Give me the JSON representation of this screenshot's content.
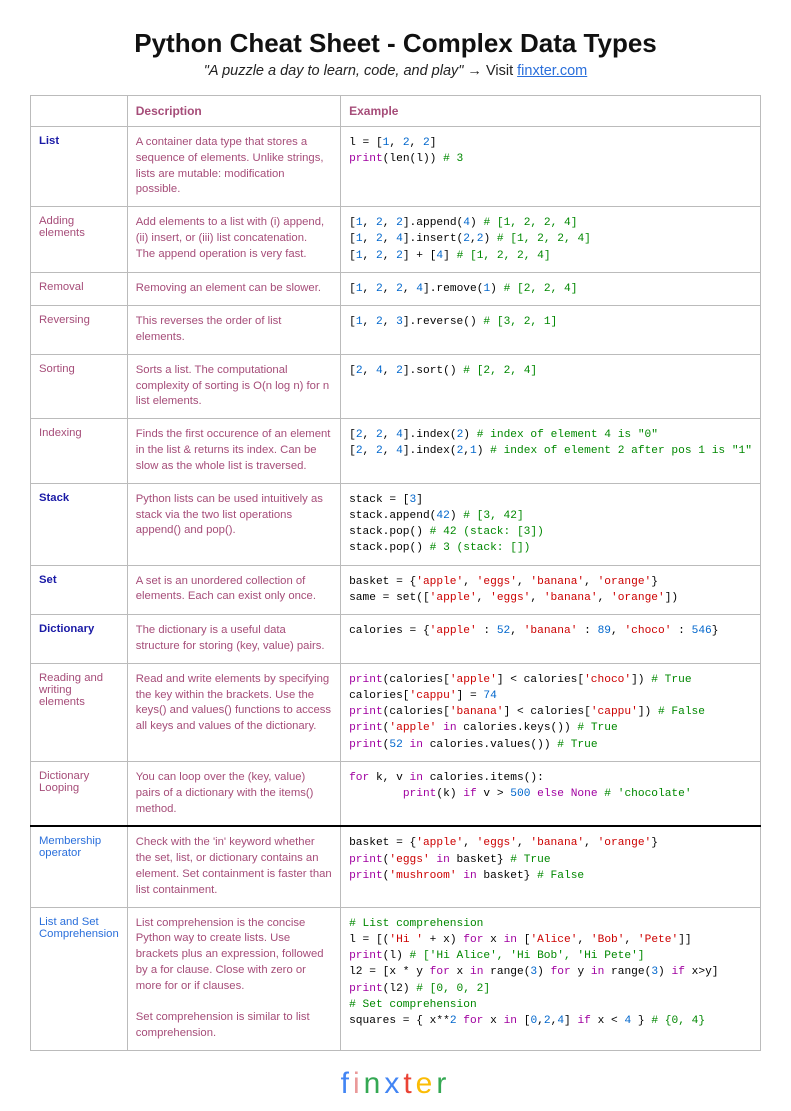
{
  "header": {
    "title": "Python Cheat Sheet - Complex Data Types",
    "subtitle_quote": "\"A puzzle a day to learn, code, and play\"",
    "subtitle_arrow": " → Visit ",
    "subtitle_link": "finxter.com"
  },
  "columns": {
    "c1": "",
    "c2": "Description",
    "c3": "Example"
  },
  "rows": [
    {
      "bold": true,
      "topic": "List",
      "desc": "A container data type that stores a sequence of elements. Unlike strings, lists are mutable: modification possible.",
      "code": [
        [
          "l = [",
          {
            "n": "1"
          },
          ", ",
          {
            "n": "2"
          },
          ", ",
          {
            "n": "2"
          },
          "]"
        ],
        [
          {
            "k": "print"
          },
          "(len(l)) ",
          {
            "c": "# 3"
          }
        ]
      ]
    },
    {
      "bold": false,
      "topic": "Adding elements",
      "desc": "Add elements to a list with (i) append, (ii) insert, or (iii) list concatenation.\nThe append operation is very fast.",
      "code": [
        [
          "[",
          {
            "n": "1"
          },
          ", ",
          {
            "n": "2"
          },
          ", ",
          {
            "n": "2"
          },
          "].append(",
          {
            "n": "4"
          },
          ") ",
          {
            "c": "# [1, 2, 2, 4]"
          }
        ],
        [
          "[",
          {
            "n": "1"
          },
          ", ",
          {
            "n": "2"
          },
          ", ",
          {
            "n": "4"
          },
          "].insert(",
          {
            "n": "2"
          },
          ",",
          {
            "n": "2"
          },
          ") ",
          {
            "c": "# [1, 2, 2, 4]"
          }
        ],
        [
          "[",
          {
            "n": "1"
          },
          ", ",
          {
            "n": "2"
          },
          ", ",
          {
            "n": "2"
          },
          "] + [",
          {
            "n": "4"
          },
          "] ",
          {
            "c": "# [1, 2, 2, 4]"
          }
        ]
      ]
    },
    {
      "bold": false,
      "topic": "Removal",
      "desc": "Removing an element can be slower.",
      "code": [
        [
          "[",
          {
            "n": "1"
          },
          ", ",
          {
            "n": "2"
          },
          ", ",
          {
            "n": "2"
          },
          ", ",
          {
            "n": "4"
          },
          "].remove(",
          {
            "n": "1"
          },
          ") ",
          {
            "c": "# [2, 2, 4]"
          }
        ]
      ]
    },
    {
      "bold": false,
      "topic": "Reversing",
      "desc": "This reverses the order of list elements.",
      "code": [
        [
          "[",
          {
            "n": "1"
          },
          ", ",
          {
            "n": "2"
          },
          ", ",
          {
            "n": "3"
          },
          "].reverse() ",
          {
            "c": "# [3, 2, 1]"
          }
        ]
      ]
    },
    {
      "bold": false,
      "topic": "Sorting",
      "desc": "Sorts a list. The computational complexity of sorting is O(n log n) for n list elements.",
      "code": [
        [
          "[",
          {
            "n": "2"
          },
          ", ",
          {
            "n": "4"
          },
          ", ",
          {
            "n": "2"
          },
          "].sort() ",
          {
            "c": "# [2, 2, 4]"
          }
        ]
      ]
    },
    {
      "bold": false,
      "topic": "Indexing",
      "desc": "Finds the first occurence of an element in the list & returns its index. Can be slow as the whole list is traversed.",
      "code": [
        [
          "[",
          {
            "n": "2"
          },
          ", ",
          {
            "n": "2"
          },
          ", ",
          {
            "n": "4"
          },
          "].index(",
          {
            "n": "2"
          },
          ") ",
          {
            "c": "# index of element 4 is \"0\""
          }
        ],
        [
          "[",
          {
            "n": "2"
          },
          ", ",
          {
            "n": "2"
          },
          ", ",
          {
            "n": "4"
          },
          "].index(",
          {
            "n": "2"
          },
          ",",
          {
            "n": "1"
          },
          ") ",
          {
            "c": "# index of element 2 after pos 1 is \"1\""
          }
        ]
      ]
    },
    {
      "bold": true,
      "topic": "Stack",
      "desc": "Python lists can be used intuitively as stack via the two list operations append() and pop().",
      "code": [
        [
          "stack = [",
          {
            "n": "3"
          },
          "]"
        ],
        [
          "stack.append(",
          {
            "n": "42"
          },
          ") ",
          {
            "c": "# [3, 42]"
          }
        ],
        [
          "stack.pop() ",
          {
            "c": "# 42 (stack: [3])"
          }
        ],
        [
          "stack.pop() ",
          {
            "c": "# 3 (stack: [])"
          }
        ]
      ]
    },
    {
      "bold": true,
      "topic": "Set",
      "desc": "A set is an unordered collection of elements. Each can exist only once.",
      "code": [
        [
          "basket = {",
          {
            "s": "'apple'"
          },
          ", ",
          {
            "s": "'eggs'"
          },
          ", ",
          {
            "s": "'banana'"
          },
          ", ",
          {
            "s": "'orange'"
          },
          "}"
        ],
        [
          "same = set([",
          {
            "s": "'apple'"
          },
          ", ",
          {
            "s": "'eggs'"
          },
          ", ",
          {
            "s": "'banana'"
          },
          ", ",
          {
            "s": "'orange'"
          },
          "])"
        ]
      ]
    },
    {
      "bold": true,
      "topic": "Dictionary",
      "desc": "The dictionary is a useful data structure for storing (key, value) pairs.",
      "code": [
        [
          "calories = {",
          {
            "s": "'apple'"
          },
          " : ",
          {
            "n": "52"
          },
          ", ",
          {
            "s": "'banana'"
          },
          " : ",
          {
            "n": "89"
          },
          ", ",
          {
            "s": "'choco'"
          },
          " : ",
          {
            "n": "546"
          },
          "}"
        ]
      ]
    },
    {
      "bold": false,
      "topic": "Reading and writing elements",
      "desc": "Read and write elements by specifying the key within the brackets. Use the keys() and values() functions to access all keys and values of the dictionary.",
      "code": [
        [
          {
            "k": "print"
          },
          "(calories[",
          {
            "s": "'apple'"
          },
          "] < calories[",
          {
            "s": "'choco'"
          },
          "]) ",
          {
            "c": "# True"
          }
        ],
        [
          "calories[",
          {
            "s": "'cappu'"
          },
          "] = ",
          {
            "n": "74"
          }
        ],
        [
          {
            "k": "print"
          },
          "(calories[",
          {
            "s": "'banana'"
          },
          "] < calories[",
          {
            "s": "'cappu'"
          },
          "]) ",
          {
            "c": "# False"
          }
        ],
        [
          {
            "k": "print"
          },
          "(",
          {
            "s": "'apple'"
          },
          " ",
          {
            "k": "in"
          },
          " calories.keys()) ",
          {
            "c": "# True"
          }
        ],
        [
          {
            "k": "print"
          },
          "(",
          {
            "n": "52"
          },
          " ",
          {
            "k": "in"
          },
          " calories.values()) ",
          {
            "c": "# True"
          }
        ]
      ]
    },
    {
      "bold": false,
      "thick": true,
      "topic": "Dictionary Looping",
      "desc": "You can loop over the (key, value) pairs of a dictionary with the items() method.",
      "code": [
        [
          {
            "k": "for"
          },
          " k, v ",
          {
            "k": "in"
          },
          " calories.items():"
        ],
        [
          "        ",
          {
            "k": "print"
          },
          "(k) ",
          {
            "k": "if"
          },
          " v > ",
          {
            "n": "500"
          },
          " ",
          {
            "k": "else"
          },
          " ",
          {
            "k": "None"
          },
          " ",
          {
            "c": "# 'chocolate'"
          }
        ]
      ]
    },
    {
      "bold": false,
      "topic": "Membership operator",
      "topicColor": "#2a6fdb",
      "desc": "Check with the 'in' keyword whether the set, list, or dictionary contains an element. Set containment is faster than list containment.",
      "code": [
        [
          "basket = {",
          {
            "s": "'apple'"
          },
          ", ",
          {
            "s": "'eggs'"
          },
          ", ",
          {
            "s": "'banana'"
          },
          ", ",
          {
            "s": "'orange'"
          },
          "}"
        ],
        [
          {
            "k": "print"
          },
          "(",
          {
            "s": "'eggs'"
          },
          " ",
          {
            "k": "in"
          },
          " basket} ",
          {
            "c": "# True"
          }
        ],
        [
          {
            "k": "print"
          },
          "(",
          {
            "s": "'mushroom'"
          },
          " ",
          {
            "k": "in"
          },
          " basket} ",
          {
            "c": "# False"
          }
        ]
      ]
    },
    {
      "bold": false,
      "topic": "List and Set Comprehension",
      "topicColor": "#2a6fdb",
      "desc": "List comprehension is the concise Python way to create lists. Use brackets plus an expression, followed by a for clause. Close with zero or more for or if clauses.\n\nSet comprehension is similar to list comprehension.",
      "code": [
        [
          {
            "c": "# List comprehension"
          }
        ],
        [
          "l = [(",
          {
            "s": "'Hi '"
          },
          " + x) ",
          {
            "k": "for"
          },
          " x ",
          {
            "k": "in"
          },
          " [",
          {
            "s": "'Alice'"
          },
          ", ",
          {
            "s": "'Bob'"
          },
          ", ",
          {
            "s": "'Pete'"
          },
          "]]"
        ],
        [
          {
            "k": "print"
          },
          "(l) ",
          {
            "c": "# ['Hi Alice', 'Hi Bob', 'Hi Pete']"
          }
        ],
        [
          "l2 = [x * y ",
          {
            "k": "for"
          },
          " x ",
          {
            "k": "in"
          },
          " range(",
          {
            "n": "3"
          },
          ") ",
          {
            "k": "for"
          },
          " y ",
          {
            "k": "in"
          },
          " range(",
          {
            "n": "3"
          },
          ") ",
          {
            "k": "if"
          },
          " x>y]"
        ],
        [
          {
            "k": "print"
          },
          "(l2) ",
          {
            "c": "# [0, 0, 2]"
          }
        ],
        [
          {
            "c": "# Set comprehension"
          }
        ],
        [
          "squares = { x**",
          {
            "n": "2"
          },
          " ",
          {
            "k": "for"
          },
          " x ",
          {
            "k": "in"
          },
          " [",
          {
            "n": "0"
          },
          ",",
          {
            "n": "2"
          },
          ",",
          {
            "n": "4"
          },
          "] ",
          {
            "k": "if"
          },
          " x < ",
          {
            "n": "4"
          },
          " } ",
          {
            "c": "# {0, 4}"
          }
        ]
      ]
    }
  ],
  "logo": {
    "letters": [
      "f",
      "i",
      "n",
      "x",
      "t",
      "e",
      "r"
    ]
  }
}
